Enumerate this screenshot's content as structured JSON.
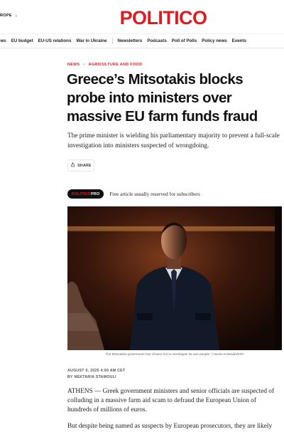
{
  "header": {
    "edition_label": "ROPE",
    "logo_text": "POLITICO"
  },
  "nav": {
    "group1": [
      "ews",
      "EU budget",
      "EU-US relations",
      "War in Ukraine"
    ],
    "group2": [
      "Newsletters",
      "Podcasts",
      "Poll of Polls",
      "Policy news",
      "Events"
    ]
  },
  "article": {
    "crumbs": [
      "NEWS",
      "AGRICULTURE AND FOOD"
    ],
    "headline": "Greece’s Mitsotakis blocks probe into ministers over massive EU farm funds fraud",
    "dek": "The prime minister is wielding his parliamentary majority to prevent a full-scale investigation into ministers suspected of wrongdoing.",
    "share_label": "SHARE",
    "pro_badge": {
      "part1": "POLITICO",
      "part2": "PRO"
    },
    "pro_text": "Free article usually reserved for subscribers",
    "image_caption": "The Mitsotakis government has chosen not to investigate its own people. | Yannis Kolesidis/EPA",
    "date": "AUGUST 6, 2025 4:00 AM CET",
    "byline": "BY NEKTARIA STAMOULI",
    "paragraphs": [
      "ATHENS — Greek government ministers and senior officials are suspected of colluding in a massive farm aid scam to defraud the European Union of hundreds of millions of euros.",
      "But despite being named as suspects by European prosecutors, they are likely"
    ]
  },
  "colors": {
    "brand_red": "#dc1c22",
    "text_dark": "#111111",
    "badge_bg": "#111111"
  },
  "icons": {
    "share": "share-icon",
    "chevron": "chevron-down-icon"
  }
}
